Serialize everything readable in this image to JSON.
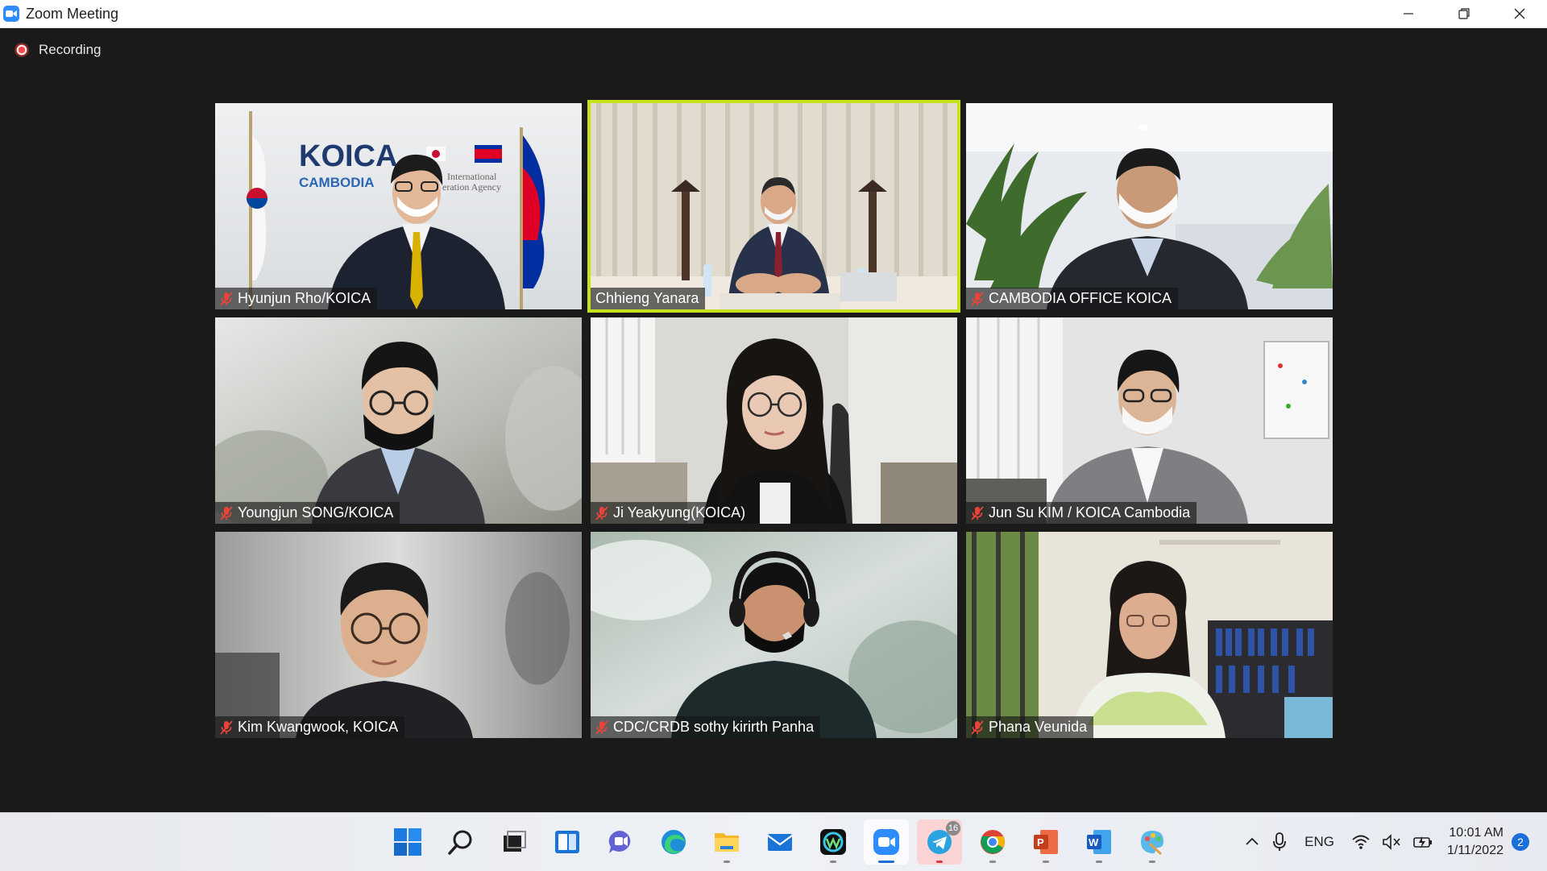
{
  "window": {
    "title": "Zoom Meeting"
  },
  "recording": {
    "label": "Recording"
  },
  "participants": [
    {
      "name": "Hyunjun Rho/KOICA",
      "muted": true
    },
    {
      "name": "Chhieng Yanara",
      "muted": false,
      "active_speaker": true
    },
    {
      "name": "CAMBODIA OFFICE KOICA",
      "muted": true
    },
    {
      "name": "Youngjun SONG/KOICA",
      "muted": true
    },
    {
      "name": "Ji Yeakyung(KOICA)",
      "muted": true
    },
    {
      "name": "Jun Su KIM / KOICA Cambodia",
      "muted": true
    },
    {
      "name": "Kim Kwangwook, KOICA",
      "muted": true
    },
    {
      "name": "CDC/CRDB sothy kirirth Panha",
      "muted": true
    },
    {
      "name": "Phana Veunida",
      "muted": true
    }
  ],
  "background_text": {
    "koica_logo": "KOICA",
    "koica_sub": "CAMBODIA",
    "koica_agency_1": "International",
    "koica_agency_2": "eration Agency"
  },
  "taskbar": {
    "telegram_badge": "16",
    "language": "ENG",
    "time": "10:01 AM",
    "date": "1/11/2022",
    "notifications": "2"
  },
  "colors": {
    "active_speaker_border": "#c6e21d",
    "muted_icon": "#e8443a",
    "zoom_blue": "#2d8cff"
  }
}
